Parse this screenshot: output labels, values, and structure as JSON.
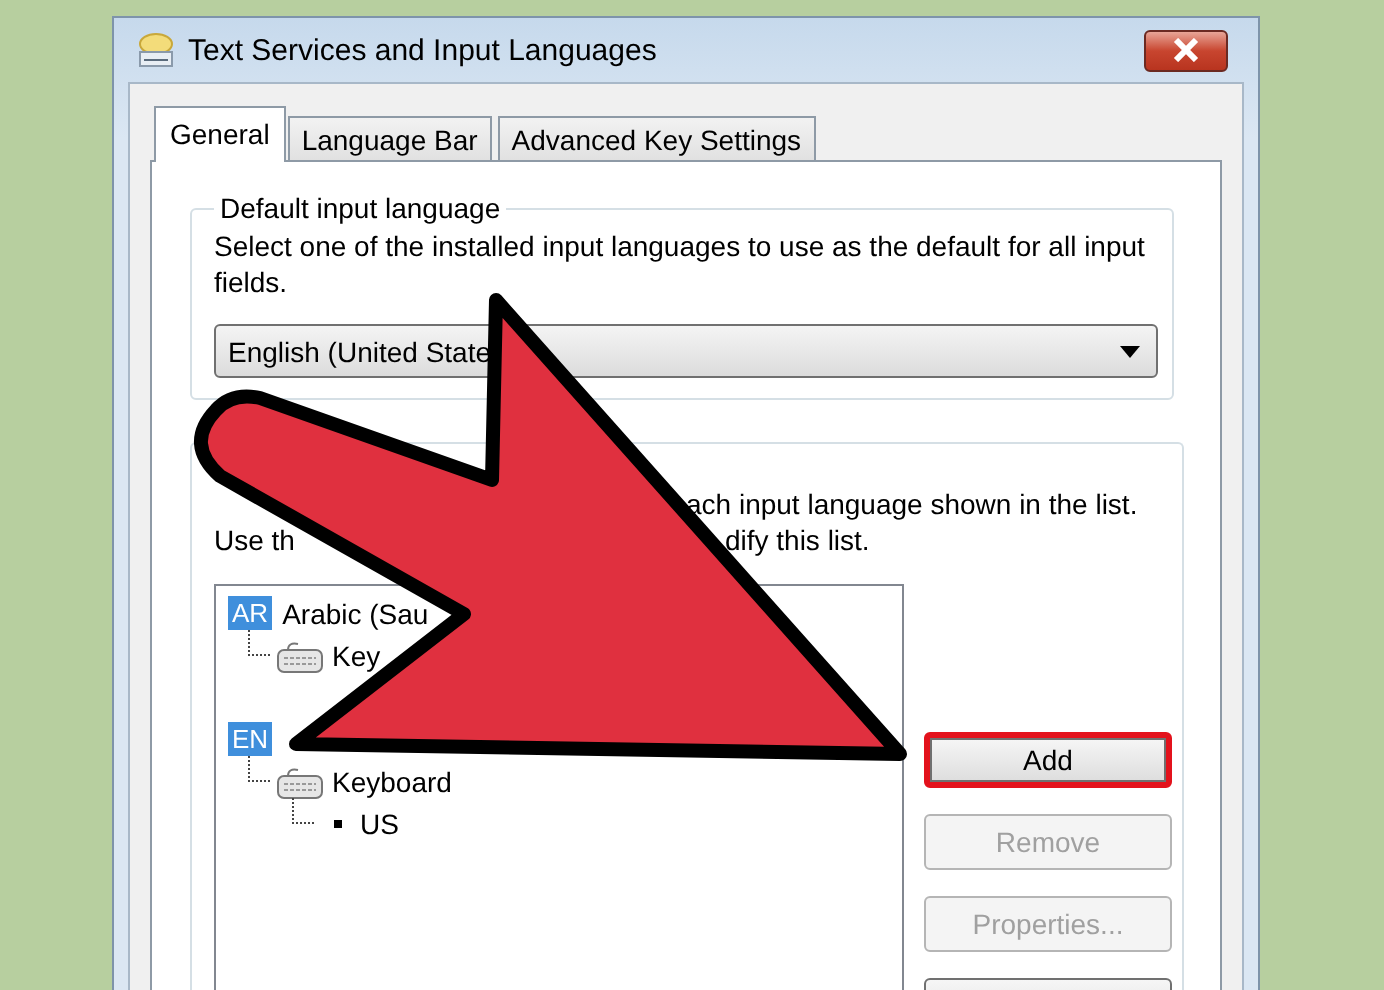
{
  "window": {
    "title": "Text Services and Input Languages"
  },
  "tabs": [
    {
      "label": "General",
      "selected": true
    },
    {
      "label": "Language Bar",
      "selected": false
    },
    {
      "label": "Advanced Key Settings",
      "selected": false
    }
  ],
  "default_input_language": {
    "title": "Default input language",
    "description": "Select one of the installed input languages to use as the default for all input fields.",
    "dropdown_value": "English (United State"
  },
  "installed_services": {
    "description_line_1": "ach input language shown in the list.",
    "description_line_2_start": "Use th",
    "description_line_2_end": "dify this list.",
    "tree": [
      {
        "badge": "AR",
        "label": "Arabic (Sau",
        "children": [
          {
            "label": "Key",
            "kind": "keyboard"
          }
        ]
      },
      {
        "badge": "EN",
        "children": [
          {
            "label": "Keyboard",
            "kind": "keyboard",
            "children": [
              {
                "label": "US",
                "kind": "layout"
              }
            ]
          }
        ]
      }
    ],
    "buttons": [
      {
        "label": "Add",
        "disabled": false,
        "highlighted": true
      },
      {
        "label": "Remove",
        "disabled": true,
        "highlighted": false
      },
      {
        "label": "Properties...",
        "disabled": true,
        "highlighted": false
      },
      {
        "disabled": false,
        "highlighted": false
      }
    ]
  }
}
